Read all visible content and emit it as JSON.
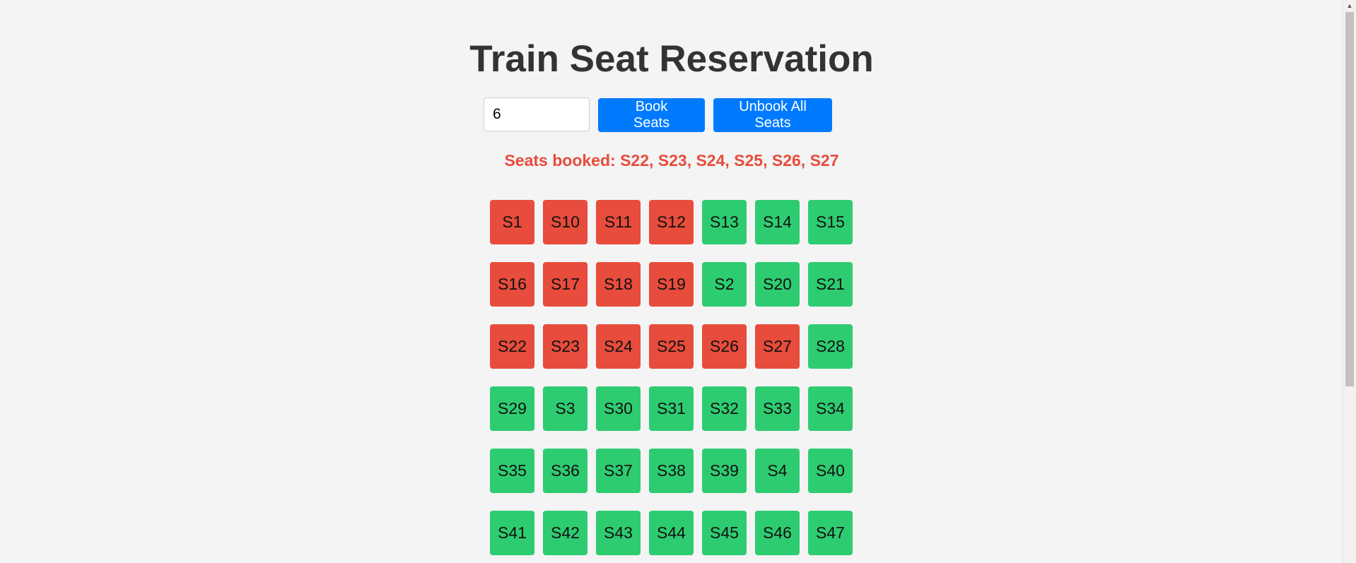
{
  "header": {
    "title": "Train Seat Reservation"
  },
  "controls": {
    "seat_count_value": "6",
    "book_label": "Book Seats",
    "unbook_label": "Unbook All Seats"
  },
  "status": {
    "message": "Seats booked: S22, S23, S24, S25, S26, S27"
  },
  "colors": {
    "available": "#2ecc71",
    "booked": "#e74c3c",
    "primary": "#007bff"
  },
  "seats": [
    {
      "id": "S1",
      "status": "booked"
    },
    {
      "id": "S10",
      "status": "booked"
    },
    {
      "id": "S11",
      "status": "booked"
    },
    {
      "id": "S12",
      "status": "booked"
    },
    {
      "id": "S13",
      "status": "available"
    },
    {
      "id": "S14",
      "status": "available"
    },
    {
      "id": "S15",
      "status": "available"
    },
    {
      "id": "S16",
      "status": "booked"
    },
    {
      "id": "S17",
      "status": "booked"
    },
    {
      "id": "S18",
      "status": "booked"
    },
    {
      "id": "S19",
      "status": "booked"
    },
    {
      "id": "S2",
      "status": "available"
    },
    {
      "id": "S20",
      "status": "available"
    },
    {
      "id": "S21",
      "status": "available"
    },
    {
      "id": "S22",
      "status": "booked"
    },
    {
      "id": "S23",
      "status": "booked"
    },
    {
      "id": "S24",
      "status": "booked"
    },
    {
      "id": "S25",
      "status": "booked"
    },
    {
      "id": "S26",
      "status": "booked"
    },
    {
      "id": "S27",
      "status": "booked"
    },
    {
      "id": "S28",
      "status": "available"
    },
    {
      "id": "S29",
      "status": "available"
    },
    {
      "id": "S3",
      "status": "available"
    },
    {
      "id": "S30",
      "status": "available"
    },
    {
      "id": "S31",
      "status": "available"
    },
    {
      "id": "S32",
      "status": "available"
    },
    {
      "id": "S33",
      "status": "available"
    },
    {
      "id": "S34",
      "status": "available"
    },
    {
      "id": "S35",
      "status": "available"
    },
    {
      "id": "S36",
      "status": "available"
    },
    {
      "id": "S37",
      "status": "available"
    },
    {
      "id": "S38",
      "status": "available"
    },
    {
      "id": "S39",
      "status": "available"
    },
    {
      "id": "S4",
      "status": "available"
    },
    {
      "id": "S40",
      "status": "available"
    },
    {
      "id": "S41",
      "status": "available"
    },
    {
      "id": "S42",
      "status": "available"
    },
    {
      "id": "S43",
      "status": "available"
    },
    {
      "id": "S44",
      "status": "available"
    },
    {
      "id": "S45",
      "status": "available"
    },
    {
      "id": "S46",
      "status": "available"
    },
    {
      "id": "S47",
      "status": "available"
    }
  ],
  "scrollbar": {
    "up_arrow_icon": "triangle-up-icon"
  }
}
